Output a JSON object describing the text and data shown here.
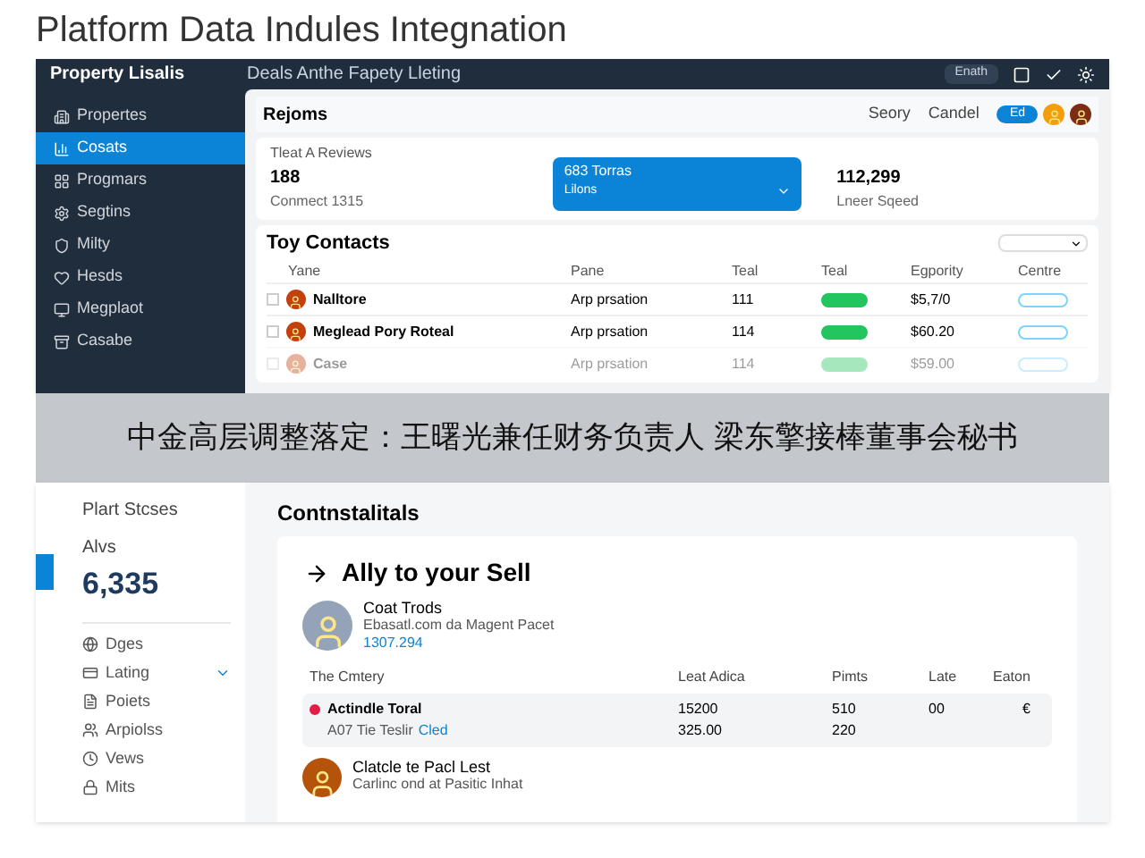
{
  "page_title": "Platform Data Indules Integnation",
  "top_window": {
    "brand": "Property Lisalis",
    "title": "Deals Anthe Fapety Lleting",
    "top_button": "Enath",
    "sidebar": [
      {
        "label": "Propertes",
        "selected": false
      },
      {
        "label": "Cosats",
        "selected": true
      },
      {
        "label": "Progmars",
        "selected": false
      },
      {
        "label": "Segtins",
        "selected": false
      },
      {
        "label": "Milty",
        "selected": false
      },
      {
        "label": "Hesds",
        "selected": false
      },
      {
        "label": "Megplaot",
        "selected": false
      },
      {
        "label": "Casabe",
        "selected": false
      }
    ],
    "header": {
      "title": "Rejoms",
      "links": [
        "Seory",
        "Candel"
      ],
      "pill": "Ed"
    },
    "stats": {
      "heading": "Tleat A Reviews",
      "items": [
        {
          "kind": "plain",
          "value": "188",
          "caption": "Conmect 1315"
        },
        {
          "kind": "highlight",
          "value": "683 Torras",
          "caption": "Lilons"
        },
        {
          "kind": "plain",
          "value": "112,299",
          "caption": "Lneer Sqeed"
        }
      ]
    },
    "contacts": {
      "title": "Toy Contacts",
      "columns": [
        "Yane",
        "Pane",
        "Teal",
        "Teal",
        "Egpority",
        "Centre"
      ],
      "rows": [
        {
          "name": "Nalltore",
          "role": "Arp prsation",
          "count": "111",
          "amount": "$5,7/0",
          "faded": false
        },
        {
          "name": "Meglead Pory Roteal",
          "role": "Arp prsation",
          "count": "114",
          "amount": "$60.20",
          "faded": false
        },
        {
          "name": "Case",
          "role": "Arp prsation",
          "count": "114",
          "amount": "$59.00",
          "faded": true
        }
      ]
    }
  },
  "banner": "中金高层调整落定：王曙光兼任财务负责人 梁东擎接棒董事会秘书",
  "bottom_window": {
    "sidebar": {
      "heading": "Plart Stcses",
      "label": "Alvs",
      "value": "6,335",
      "items": [
        {
          "label": "Dges",
          "expanded": false
        },
        {
          "label": "Lating",
          "expanded": true
        },
        {
          "label": "Poiets",
          "expanded": false
        },
        {
          "label": "Arpiolss",
          "expanded": false
        },
        {
          "label": "Vews",
          "expanded": false
        },
        {
          "label": "Mits",
          "expanded": false
        }
      ]
    },
    "heading": "Contnstalitals",
    "card": {
      "title": "Ally to your Sell",
      "profile": {
        "name": "Coat Trods",
        "line": "Ebasatl.com da Magent Pacet",
        "link": "1307.294"
      },
      "columns": [
        "The Cmtery",
        "Leat Adica",
        "Pimts",
        "Late",
        "Eaton"
      ],
      "row": {
        "color": "#e11d48",
        "title": "Actindle Toral",
        "sub": "A07 Tie Teslir",
        "sub_link": "Cled",
        "lead": [
          "15200",
          "325.00"
        ],
        "points": [
          "510",
          "220"
        ],
        "late": "00",
        "eaton": "€"
      },
      "profile2": {
        "name": "Clatcle te Pacl Lest",
        "line": "Carlinc ond at Pasitic Inhat"
      }
    }
  }
}
